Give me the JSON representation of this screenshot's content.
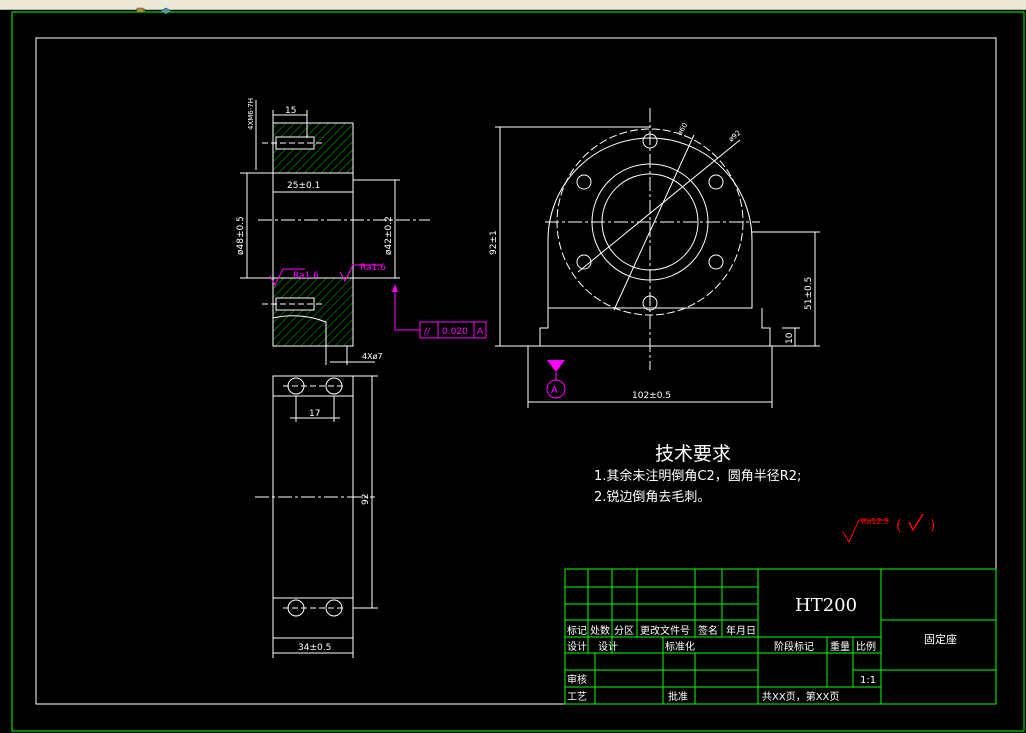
{
  "colors": {
    "background": "#000000",
    "frame": "#00ff00",
    "geometry": "#ffffff",
    "hatch": "#00a000",
    "dimension": "#ffffff",
    "roughness": "#ff00ff",
    "tolerance": "#ff00ff",
    "finish_note": "#ff0000"
  },
  "toolbar": {
    "icons": [
      "coffee-icon",
      "layers-icon"
    ]
  },
  "views": {
    "section": {
      "dims": {
        "d15": "15",
        "d25": "25±0.1",
        "d48": "ø48±0.5",
        "d42": "ø42±0.2",
        "depth": "4XM6-7H",
        "bottom": "4Xø7"
      },
      "roughness": {
        "left": "Ra1.6",
        "right": "Ra1.6"
      },
      "tolerance": {
        "symbol": "//",
        "value": "0.020",
        "datum": "A"
      }
    },
    "front": {
      "dims": {
        "d92": "92±1",
        "d51": "51±0.5",
        "d102": "102±0.5",
        "d10": "10",
        "dia_a": "ø60",
        "dia_b": "ø92"
      },
      "datum": "A"
    },
    "top": {
      "dims": {
        "d17": "17",
        "d34": "34±0.5",
        "d92": "92"
      }
    }
  },
  "requirements": {
    "title": "技术要求",
    "items": [
      "1.其余未注明倒角C2，圆角半径R2;",
      "2.锐边倒角去毛刺。"
    ]
  },
  "finish": {
    "value": "Ra12.5",
    "open": "(",
    "close": ")"
  },
  "title_block": {
    "material": "HT200",
    "part_name": "固定座",
    "headers": [
      "标记",
      "处数",
      "分区",
      "更改文件号",
      "签名",
      "年月日"
    ],
    "row_design": [
      "设计",
      "设计",
      "标准化"
    ],
    "stage_headers": [
      "阶段标记",
      "重量",
      "比例"
    ],
    "scale": "1:1",
    "review": "审核",
    "process": "工艺",
    "approve": "批准",
    "sheets": "共XX页，第XX页"
  }
}
